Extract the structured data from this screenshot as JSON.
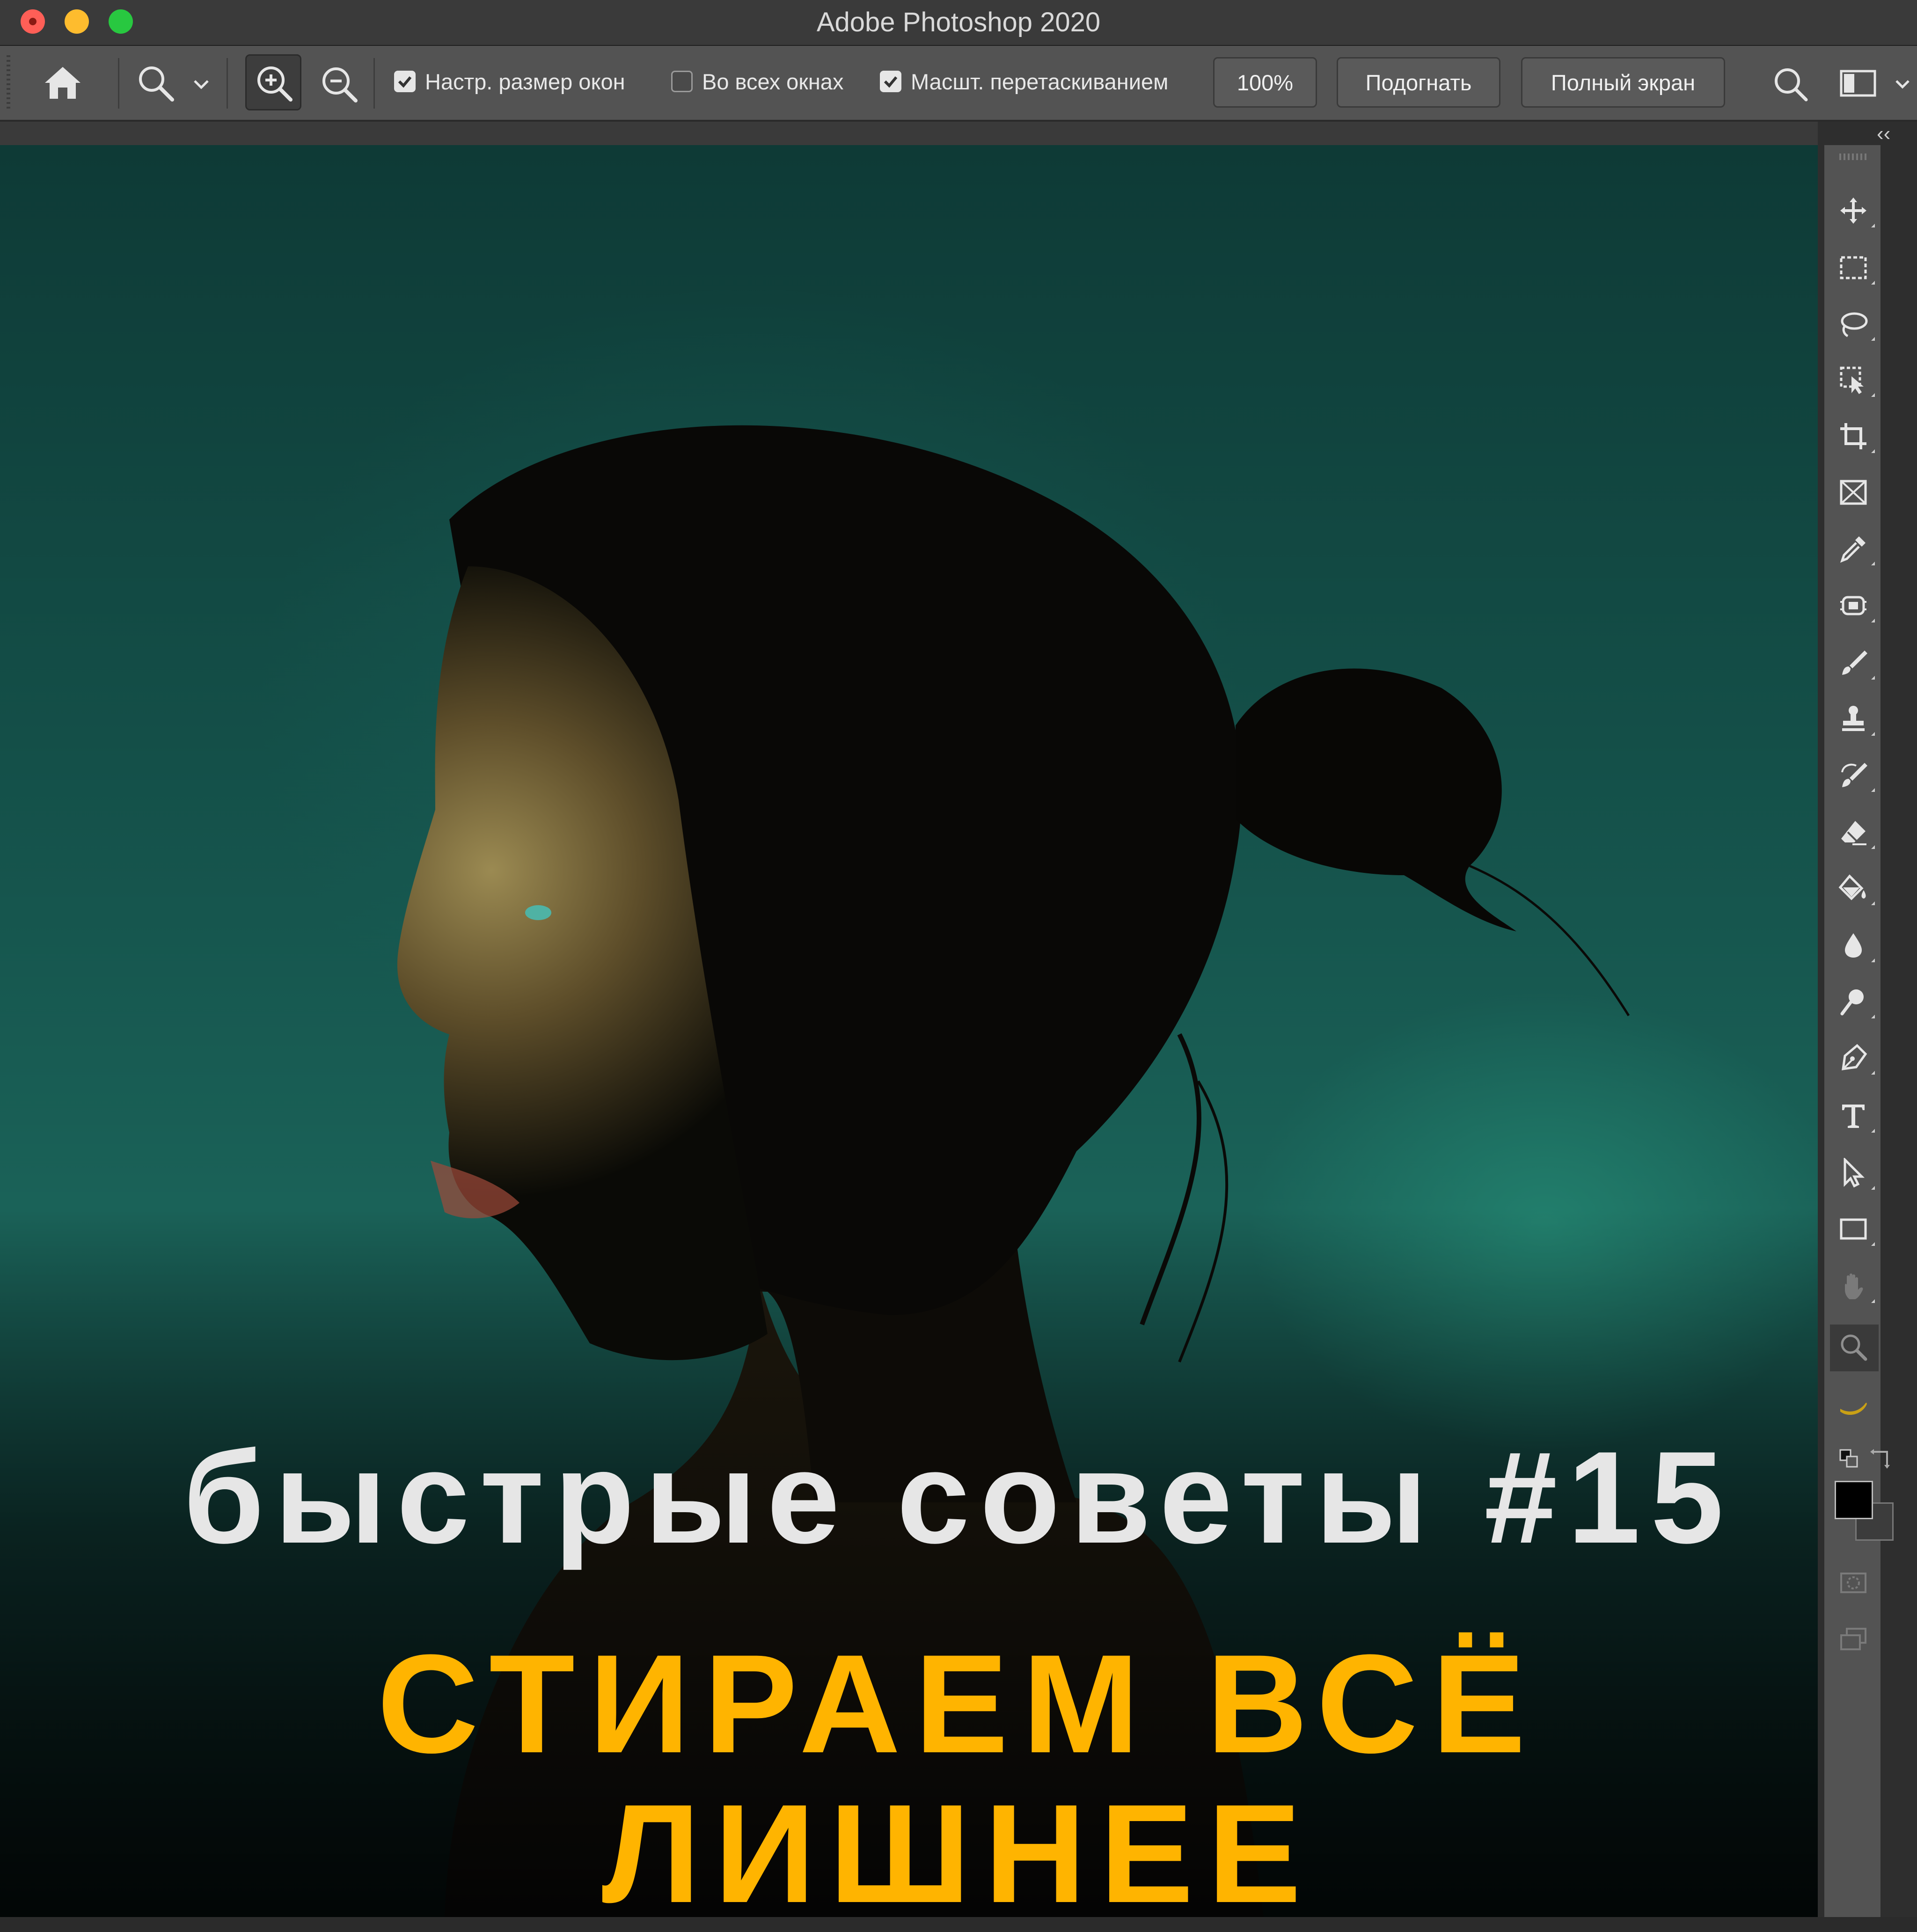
{
  "window": {
    "title": "Adobe Photoshop 2020"
  },
  "options_bar": {
    "checkbox_resize_windows": {
      "label": "Настр. размер окон",
      "checked": true
    },
    "checkbox_all_windows": {
      "label": "Во всех окнах",
      "checked": false
    },
    "checkbox_scrubby_zoom": {
      "label": "Масшт. перетаскиванием",
      "checked": true
    },
    "zoom_value": "100%",
    "fit_button": "Подогнать",
    "fullscreen_button": "Полный экран"
  },
  "canvas": {
    "headline_top": "быстрые советы #15",
    "headline_bottom": "СТИРАЕМ ВСЁ ЛИШНЕЕ",
    "colors": {
      "headline_top": "#e6e6e6",
      "headline_bottom": "#ffb400",
      "background": "#145049"
    }
  },
  "toolbar": {
    "tools": [
      "move-icon",
      "marquee-icon",
      "lasso-icon",
      "object-selection-icon",
      "crop-icon",
      "frame-icon",
      "eyedropper-icon",
      "healing-icon",
      "brush-icon",
      "stamp-icon",
      "history-brush-icon",
      "eraser-icon",
      "paint-bucket-icon",
      "blur-icon",
      "dodge-icon",
      "pen-icon",
      "type-icon",
      "path-selection-icon",
      "rectangle-icon",
      "hand-icon",
      "zoom-icon",
      "banana-icon"
    ],
    "active_tool": "zoom-icon",
    "foreground_color": "#000000",
    "background_color": "#3c3c3c"
  }
}
